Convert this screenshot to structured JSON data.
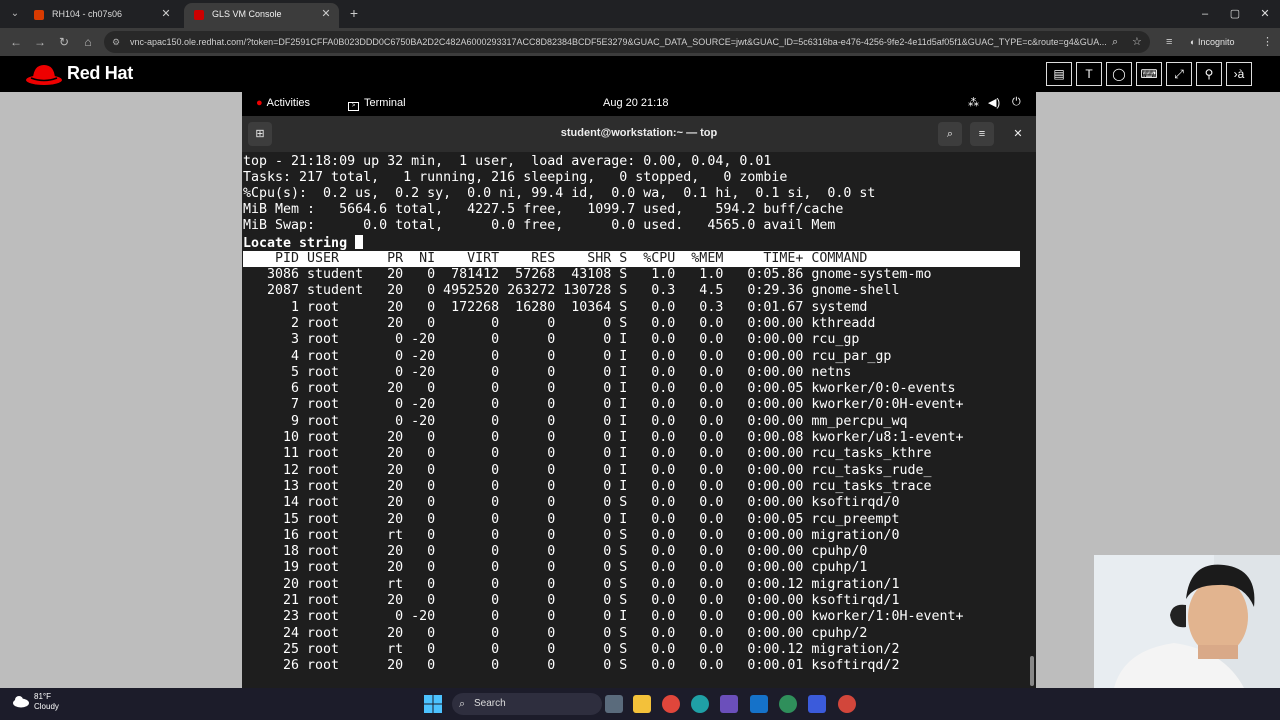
{
  "browser": {
    "tabs": [
      {
        "label": "RH104 - ch07s06",
        "close": "✕",
        "active": false,
        "favicon_color": "#d83b01"
      },
      {
        "label": "GLS VM Console",
        "close": "✕",
        "active": true,
        "favicon_color": "#cc0000"
      }
    ],
    "new_tab": "+",
    "window_controls": [
      "–",
      "▢",
      "✕"
    ],
    "url": "vnc-apac150.ole.redhat.com/?token=DF2591CFFA0B023DDD0C6750BA2D2C482A6000293317ACC8D82384BCDF5E3279&GUAC_DATA_SOURCE=jwt&GUAC_ID=5c6316ba-e476-4256-9fe2-4e11d5af05f1&GUAC_TYPE=c&route=g4&GUA...",
    "incognito_label": "Incognito"
  },
  "redhat": {
    "brand": "Red Hat",
    "tools": [
      "clipboard-icon",
      "text-icon",
      "refresh-icon",
      "keyboard-icon",
      "fullscreen-icon",
      "user-icon",
      "translate-icon"
    ]
  },
  "gnome": {
    "activities": "Activities",
    "app": "Terminal",
    "clock": "Aug 20  21:18"
  },
  "terminal": {
    "title": "student@workstation:~ — top",
    "summary": [
      "top - 21:18:09 up 32 min,  1 user,  load average: 0.00, 0.04, 0.01",
      "Tasks: 217 total,   1 running, 216 sleeping,   0 stopped,   0 zombie",
      "%Cpu(s):  0.2 us,  0.2 sy,  0.0 ni, 99.4 id,  0.0 wa,  0.1 hi,  0.1 si,  0.0 st",
      "MiB Mem :   5664.6 total,   4227.5 free,   1099.7 used,    594.2 buff/cache",
      "MiB Swap:      0.0 total,      0.0 free,      0.0 used.   4565.0 avail Mem",
      "Locate string "
    ],
    "header": "    PID USER      PR  NI    VIRT    RES    SHR S  %CPU  %MEM     TIME+ COMMAND",
    "rows": [
      "   3086 student   20   0  781412  57268  43108 S   1.0   1.0   0:05.86 gnome-system-mo",
      "   2087 student   20   0 4952520 263272 130728 S   0.3   4.5   0:29.36 gnome-shell",
      "      1 root      20   0  172268  16280  10364 S   0.0   0.3   0:01.67 systemd",
      "      2 root      20   0       0      0      0 S   0.0   0.0   0:00.00 kthreadd",
      "      3 root       0 -20       0      0      0 I   0.0   0.0   0:00.00 rcu_gp",
      "      4 root       0 -20       0      0      0 I   0.0   0.0   0:00.00 rcu_par_gp",
      "      5 root       0 -20       0      0      0 I   0.0   0.0   0:00.00 netns",
      "      6 root      20   0       0      0      0 I   0.0   0.0   0:00.05 kworker/0:0-events",
      "      7 root       0 -20       0      0      0 I   0.0   0.0   0:00.00 kworker/0:0H-event+",
      "      9 root       0 -20       0      0      0 I   0.0   0.0   0:00.00 mm_percpu_wq",
      "     10 root      20   0       0      0      0 I   0.0   0.0   0:00.08 kworker/u8:1-event+",
      "     11 root      20   0       0      0      0 I   0.0   0.0   0:00.00 rcu_tasks_kthre",
      "     12 root      20   0       0      0      0 I   0.0   0.0   0:00.00 rcu_tasks_rude_",
      "     13 root      20   0       0      0      0 I   0.0   0.0   0:00.00 rcu_tasks_trace",
      "     14 root      20   0       0      0      0 S   0.0   0.0   0:00.00 ksoftirqd/0",
      "     15 root      20   0       0      0      0 I   0.0   0.0   0:00.05 rcu_preempt",
      "     16 root      rt   0       0      0      0 S   0.0   0.0   0:00.00 migration/0",
      "     18 root      20   0       0      0      0 S   0.0   0.0   0:00.00 cpuhp/0",
      "     19 root      20   0       0      0      0 S   0.0   0.0   0:00.00 cpuhp/1",
      "     20 root      rt   0       0      0      0 S   0.0   0.0   0:00.12 migration/1",
      "     21 root      20   0       0      0      0 S   0.0   0.0   0:00.00 ksoftirqd/1",
      "     23 root       0 -20       0      0      0 I   0.0   0.0   0:00.00 kworker/1:0H-event+",
      "     24 root      20   0       0      0      0 S   0.0   0.0   0:00.00 cpuhp/2",
      "     25 root      rt   0       0      0      0 S   0.0   0.0   0:00.12 migration/2",
      "     26 root      20   0       0      0      0 S   0.0   0.0   0:00.01 ksoftirqd/2"
    ]
  },
  "taskbar": {
    "temp": "81°F",
    "weather": "Cloudy",
    "search": "Search"
  }
}
